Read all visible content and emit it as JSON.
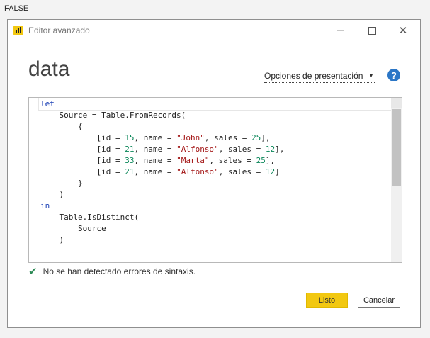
{
  "top_value": "FALSE",
  "window": {
    "title": "Editor avanzado"
  },
  "query_name": "data",
  "options_dropdown": {
    "label": "Opciones de presentación"
  },
  "help": {
    "glyph": "?"
  },
  "code_lines": [
    [
      {
        "t": "let",
        "c": "kw"
      }
    ],
    [
      {
        "t": "    Source = Table.FromRecords(",
        "c": ""
      }
    ],
    [
      {
        "t": "        {",
        "c": ""
      }
    ],
    [
      {
        "t": "            [id = ",
        "c": ""
      },
      {
        "t": "15",
        "c": "num"
      },
      {
        "t": ", name = ",
        "c": ""
      },
      {
        "t": "\"John\"",
        "c": "str"
      },
      {
        "t": ", sales = ",
        "c": ""
      },
      {
        "t": "25",
        "c": "num"
      },
      {
        "t": "],",
        "c": ""
      }
    ],
    [
      {
        "t": "            [id = ",
        "c": ""
      },
      {
        "t": "21",
        "c": "num"
      },
      {
        "t": ", name = ",
        "c": ""
      },
      {
        "t": "\"Alfonso\"",
        "c": "str"
      },
      {
        "t": ", sales = ",
        "c": ""
      },
      {
        "t": "12",
        "c": "num"
      },
      {
        "t": "],",
        "c": ""
      }
    ],
    [
      {
        "t": "            [id = ",
        "c": ""
      },
      {
        "t": "33",
        "c": "num"
      },
      {
        "t": ", name = ",
        "c": ""
      },
      {
        "t": "\"Marta\"",
        "c": "str"
      },
      {
        "t": ", sales = ",
        "c": ""
      },
      {
        "t": "25",
        "c": "num"
      },
      {
        "t": "],",
        "c": ""
      }
    ],
    [
      {
        "t": "            [id = ",
        "c": ""
      },
      {
        "t": "21",
        "c": "num"
      },
      {
        "t": ", name = ",
        "c": ""
      },
      {
        "t": "\"Alfonso\"",
        "c": "str"
      },
      {
        "t": ", sales = ",
        "c": ""
      },
      {
        "t": "12",
        "c": "num"
      },
      {
        "t": "]",
        "c": ""
      }
    ],
    [
      {
        "t": "        }",
        "c": ""
      }
    ],
    [
      {
        "t": "    )",
        "c": ""
      }
    ],
    [
      {
        "t": "in",
        "c": "kw"
      }
    ],
    [
      {
        "t": "    Table.IsDistinct(",
        "c": ""
      }
    ],
    [
      {
        "t": "        Source",
        "c": ""
      }
    ],
    [
      {
        "t": "    )",
        "c": ""
      }
    ]
  ],
  "status": {
    "message": "No se han detectado errores de sintaxis."
  },
  "buttons": {
    "done": "Listo",
    "cancel": "Cancelar"
  },
  "colors": {
    "accent": "#f2c811",
    "keyword": "#1a3fb5",
    "number": "#098658",
    "string": "#a31515",
    "success": "#2e8b57",
    "help": "#2b76c6"
  }
}
